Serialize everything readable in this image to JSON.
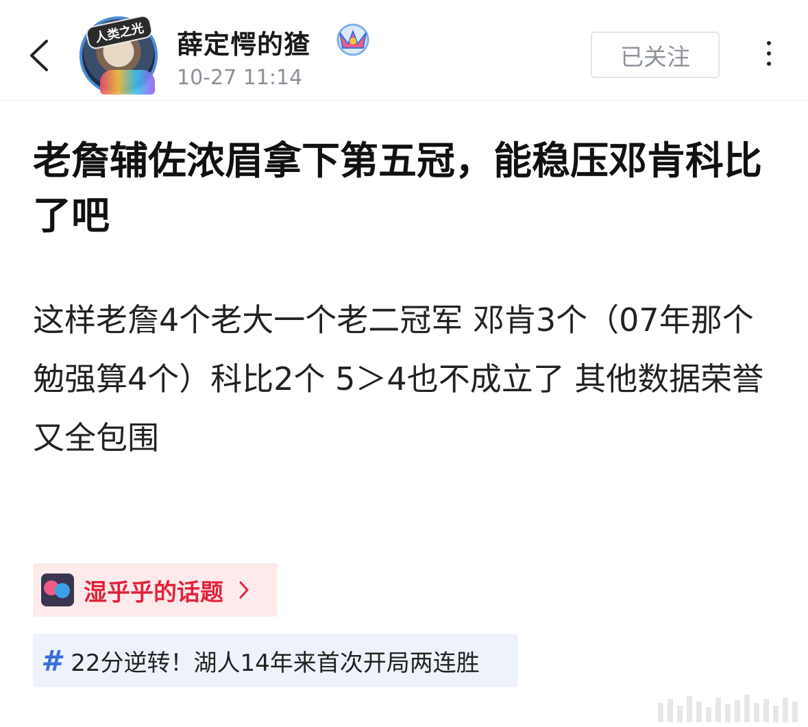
{
  "header": {
    "username": "薛定愕的猹",
    "avatar_ribbon_text": "人类之光",
    "time": "10-27 11:14",
    "follow_label": "已关注"
  },
  "post": {
    "title": "老詹辅佐浓眉拿下第五冠，能稳压邓肯科比了吧",
    "content": "这样老詹4个老大一个老二冠军 邓肯3个（07年那个勉强算4个）科比2个 5＞4也不成立了 其他数据荣誉又全包围"
  },
  "topic": {
    "label": "湿乎乎的话题"
  },
  "hashtag": {
    "label": "22分逆转！湖人14年来首次开局两连胜"
  },
  "colors": {
    "topic_red": "#e0233a",
    "hashtag_blue": "#3a6fe0",
    "muted_gray": "#8a8f99"
  }
}
